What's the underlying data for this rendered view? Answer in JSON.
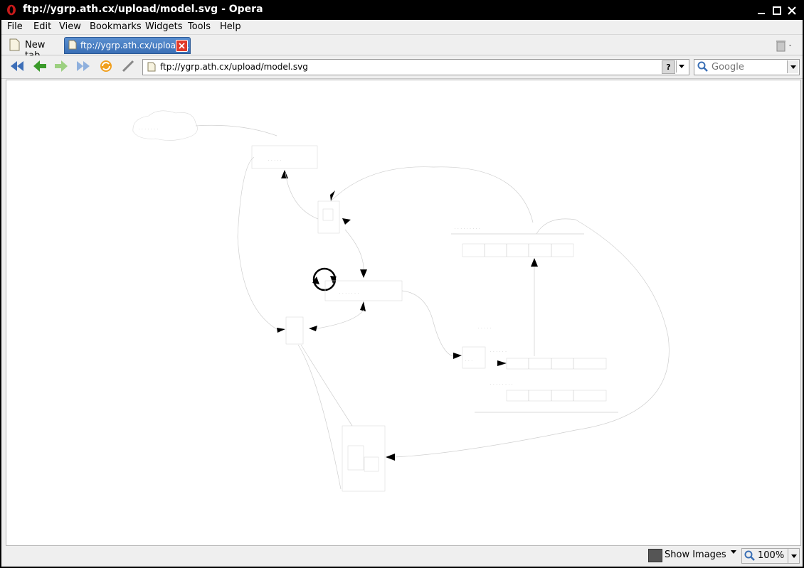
{
  "window": {
    "title": "ftp://ygrp.ath.cx/upload/model.svg - Opera"
  },
  "menubar": {
    "items": [
      {
        "label": "File"
      },
      {
        "label": "Edit"
      },
      {
        "label": "View"
      },
      {
        "label": "Bookmarks"
      },
      {
        "label": "Widgets"
      },
      {
        "label": "Tools"
      },
      {
        "label": "Help"
      }
    ]
  },
  "tabs": {
    "new_tab_label": "New tab",
    "active_label": "ftp://ygrp.ath.cx/upload..."
  },
  "toolbar": {
    "address_value": "ftp://ygrp.ath.cx/upload/model.svg",
    "search_placeholder": "Google",
    "help_label": "?"
  },
  "statusbar": {
    "show_images_label": "Show Images",
    "zoom_label": "100%"
  },
  "icons": {
    "back": "rewind-icon",
    "prev": "back-arrow-icon",
    "next": "forward-arrow-icon",
    "fast_forward": "fast-forward-icon",
    "reload": "reload-icon",
    "edit": "pencil-icon"
  },
  "colors": {
    "accent": "#3a6fb5",
    "close_red": "#e03a2a"
  }
}
